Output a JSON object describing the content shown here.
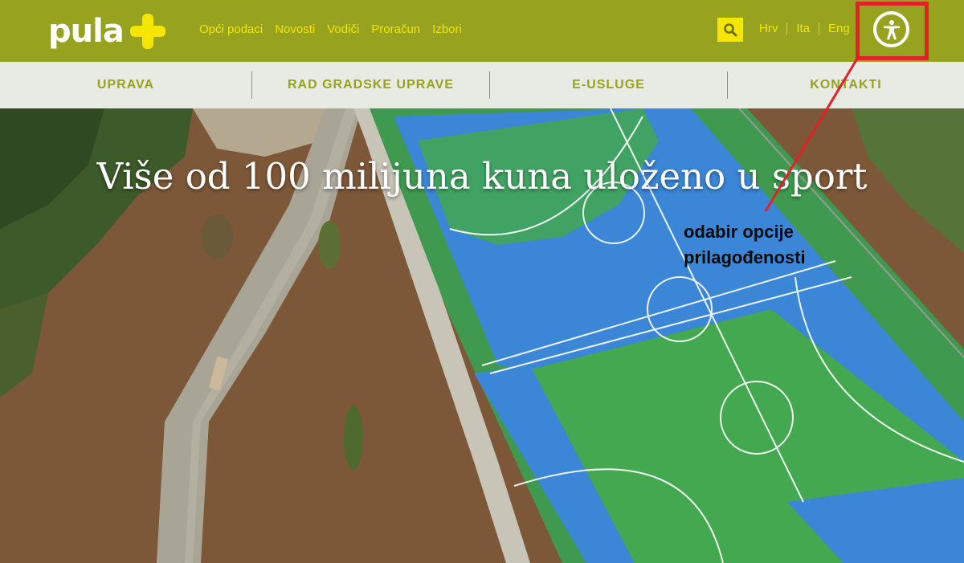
{
  "header": {
    "logo_text": "pula",
    "nav": [
      "Opći podaci",
      "Novosti",
      "Vodiči",
      "Proračun",
      "Izbori"
    ],
    "languages": [
      "Hrv",
      "Ita",
      "Eng"
    ],
    "search_icon": "search-icon",
    "accessibility_icon": "accessibility-icon"
  },
  "subnav": [
    "UPRAVA",
    "RAD GRADSKE UPRAVE",
    "E-USLUGE",
    "KONTAKTI"
  ],
  "hero": {
    "headline": "Više od 100 milijuna kuna uloženo u sport"
  },
  "annotation": {
    "line1": "odabir opcije",
    "line2": "prilagođenosti"
  },
  "colors": {
    "brand_green": "#97a21f",
    "brand_yellow": "#f4e600",
    "highlight_red": "#e3202a"
  }
}
